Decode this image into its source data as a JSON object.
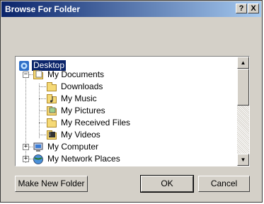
{
  "window": {
    "title": "Browse For Folder",
    "help_button": "?",
    "close_button": "X"
  },
  "tree": {
    "items": [
      {
        "label": "Desktop",
        "icon": "desktop-icon",
        "selected": true
      },
      {
        "label": "My Documents",
        "icon": "documents-folder-icon",
        "expander": "−"
      },
      {
        "label": "Downloads",
        "icon": "folder-icon"
      },
      {
        "label": "My Music",
        "icon": "music-folder-icon"
      },
      {
        "label": "My Pictures",
        "icon": "pictures-folder-icon"
      },
      {
        "label": "My Received Files",
        "icon": "folder-icon"
      },
      {
        "label": "My Videos",
        "icon": "videos-folder-icon"
      },
      {
        "label": "My Computer",
        "icon": "computer-icon",
        "expander": "+"
      },
      {
        "label": "My Network Places",
        "icon": "network-icon",
        "expander": "+"
      }
    ]
  },
  "scrollbar": {
    "up_arrow": "▲",
    "down_arrow": "▼"
  },
  "buttons": {
    "make_new_folder": "Make New Folder",
    "ok": "OK",
    "cancel": "Cancel"
  },
  "colors": {
    "titlebar_start": "#0a246a",
    "titlebar_end": "#a6caf0",
    "selection": "#0a246a",
    "face": "#d4d0c8"
  }
}
